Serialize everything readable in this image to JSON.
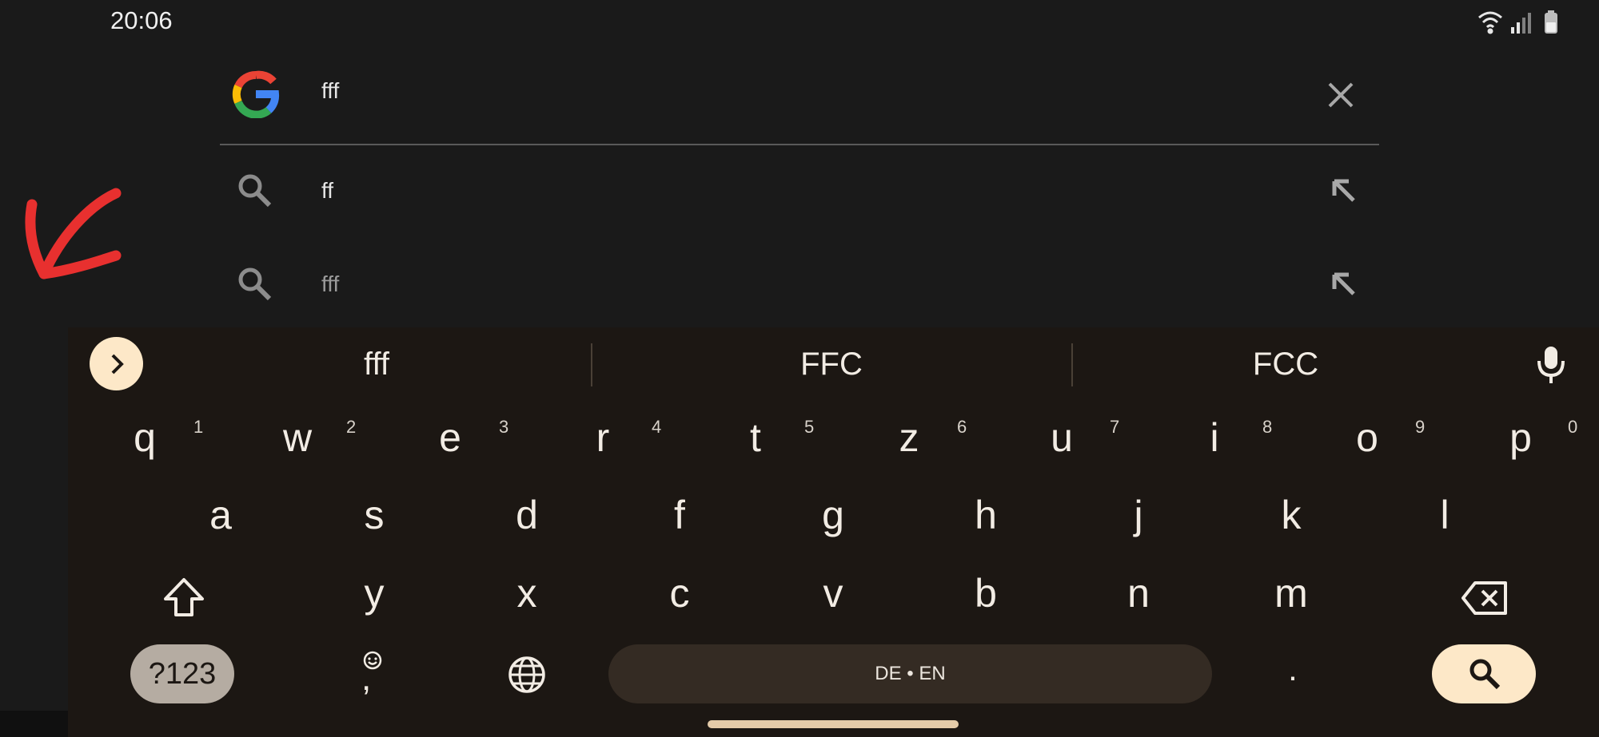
{
  "status_bar": {
    "time": "20:06",
    "icons": [
      "wifi-icon",
      "signal-icon",
      "battery-icon"
    ]
  },
  "search": {
    "query": "fff",
    "engine_icon": "google-logo-icon",
    "clear_icon": "close-icon"
  },
  "suggestions": [
    {
      "text": "ff",
      "icon": "search-icon",
      "action_icon": "fill-arrow-icon"
    },
    {
      "text": "fff",
      "icon": "search-icon",
      "action_icon": "fill-arrow-icon"
    }
  ],
  "keyboard": {
    "toolbar_icon": "chevron-right-icon",
    "word_suggestions": [
      "fff",
      "FFC",
      "FCC"
    ],
    "mic_icon": "microphone-icon",
    "row1": [
      {
        "key": "q",
        "num": "1"
      },
      {
        "key": "w",
        "num": "2"
      },
      {
        "key": "e",
        "num": "3"
      },
      {
        "key": "r",
        "num": "4"
      },
      {
        "key": "t",
        "num": "5"
      },
      {
        "key": "z",
        "num": "6"
      },
      {
        "key": "u",
        "num": "7"
      },
      {
        "key": "i",
        "num": "8"
      },
      {
        "key": "o",
        "num": "9"
      },
      {
        "key": "p",
        "num": "0"
      }
    ],
    "row2": [
      "a",
      "s",
      "d",
      "f",
      "g",
      "h",
      "j",
      "k",
      "l"
    ],
    "row3": [
      "y",
      "x",
      "c",
      "v",
      "b",
      "n",
      "m"
    ],
    "symbols_label": "?123",
    "comma_label": ",",
    "space_label": "DE • EN",
    "period_label": ".",
    "colors": {
      "accent": "#fde8c8",
      "panel": "#1c1713",
      "key_dark": "#342b23"
    }
  },
  "annotation": {
    "color": "#e8302f"
  }
}
